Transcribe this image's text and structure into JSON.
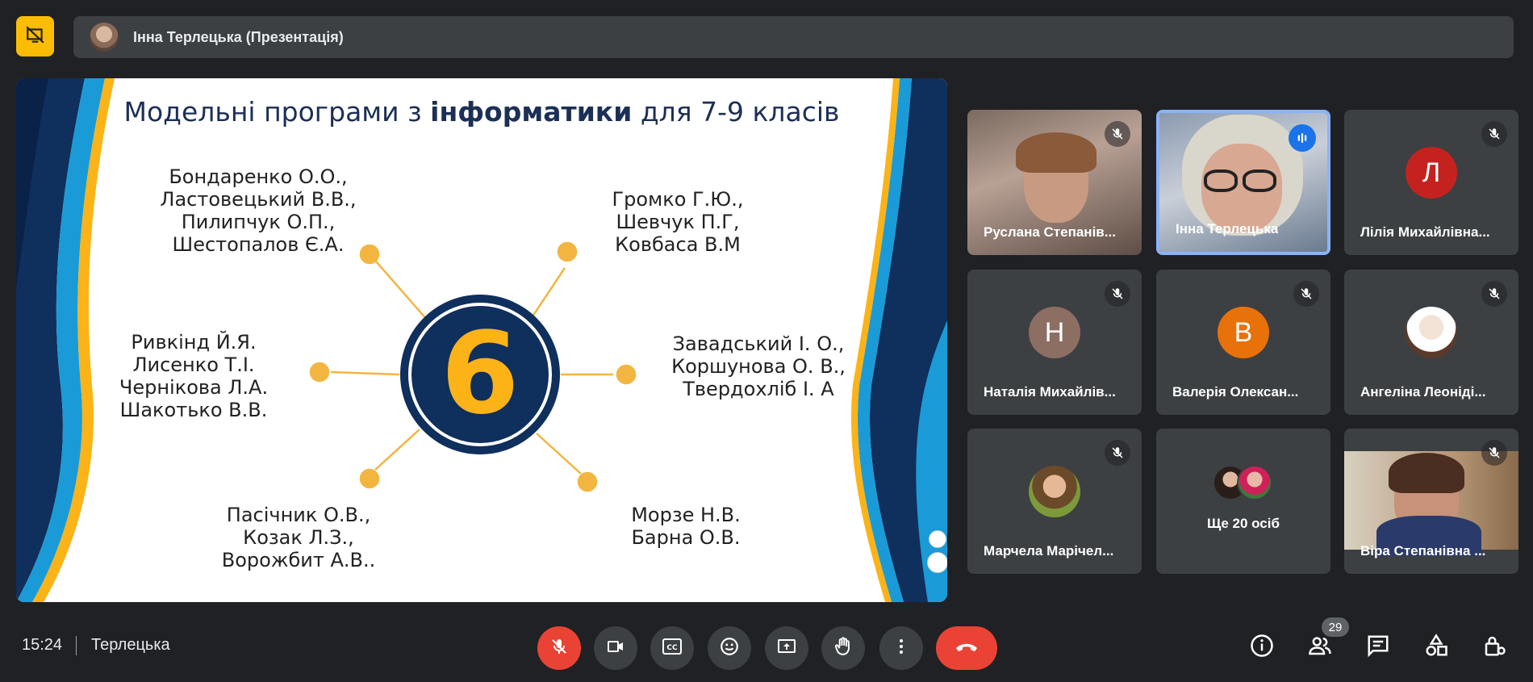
{
  "header": {
    "presenter_name": "Інна Терлецька (Презентація)"
  },
  "slide": {
    "title_pre": "Модельні програми з ",
    "title_bold": "інформатики",
    "title_post": " для 7-9 класів",
    "center_number": "6",
    "groups": [
      {
        "lines": [
          "Бондаренко О.О.,",
          "Ластовецький В.В.,",
          "Пилипчук О.П.,",
          "Шестопалов Є.А."
        ]
      },
      {
        "lines": [
          "Громко Г.Ю.,",
          "Шевчук П.Г,",
          "Ковбаса В.М"
        ]
      },
      {
        "lines": [
          "Ривкінд Й.Я.",
          "Лисенко Т.І.",
          "Чернікова Л.А.",
          "Шакотько В.В."
        ]
      },
      {
        "lines": [
          "Завадський І. О.,",
          "Коршунова О. В.,",
          "Твердохліб І. А"
        ]
      },
      {
        "lines": [
          "Пасічник О.В.,",
          "Козак Л.З.,",
          "Ворожбит А.В.."
        ]
      },
      {
        "lines": [
          "Морзе Н.В.",
          "Барна О.В."
        ]
      }
    ]
  },
  "participants": [
    {
      "name": "Руслана Степанів...",
      "muted": true,
      "type": "video"
    },
    {
      "name": "Інна Терлецька",
      "muted": false,
      "type": "video",
      "speaking": true
    },
    {
      "name": "Лілія Михайлівна...",
      "muted": true,
      "type": "avatar",
      "initial": "Л",
      "color": "#c5221f"
    },
    {
      "name": "Наталія Михайлів...",
      "muted": true,
      "type": "avatar",
      "initial": "Н",
      "color": "#8d6e63"
    },
    {
      "name": "Валерія Олексан...",
      "muted": true,
      "type": "avatar",
      "initial": "В",
      "color": "#e8710a"
    },
    {
      "name": "Ангеліна Леоніді...",
      "muted": true,
      "type": "photo"
    },
    {
      "name": "Марчела Марічел...",
      "muted": true,
      "type": "photo"
    },
    {
      "name": "Ще 20 осіб",
      "muted": false,
      "type": "more"
    },
    {
      "name": "Віра Степанівна ...",
      "muted": true,
      "type": "video"
    }
  ],
  "bottom": {
    "time": "15:24",
    "meeting_name": "Терлецька",
    "participants_count": "29"
  },
  "colors": {
    "accent_yellow": "#fbbc04",
    "end_call_red": "#ea4335",
    "speaking_blue": "#1a73e8",
    "slide_navy": "#0f2f5c"
  }
}
